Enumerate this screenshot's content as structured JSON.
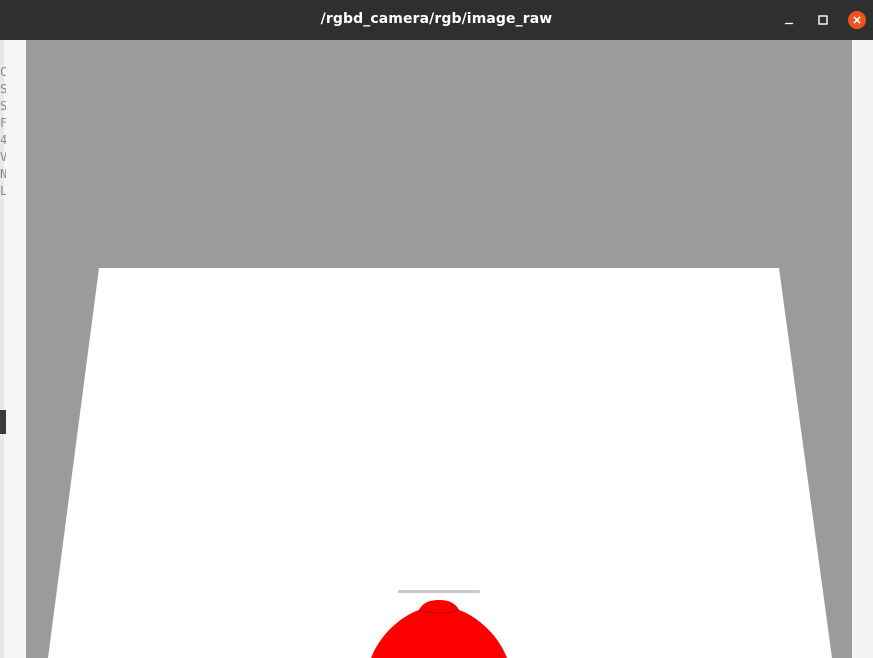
{
  "window": {
    "title": "/rgbd_camera/rgb/image_raw",
    "controls": {
      "minimize_icon": "minimize-icon",
      "maximize_icon": "maximize-icon",
      "close_icon": "close-icon"
    }
  },
  "background_window": {
    "partial_text": "C\nS\nS\nF\n4\nV\nN\nL"
  },
  "colors": {
    "titlebar": "#2f2f2f",
    "close_button": "#e95420",
    "sky": "#9b9b9b",
    "ground_plane": "#ffffff",
    "object": "#ff0000"
  }
}
